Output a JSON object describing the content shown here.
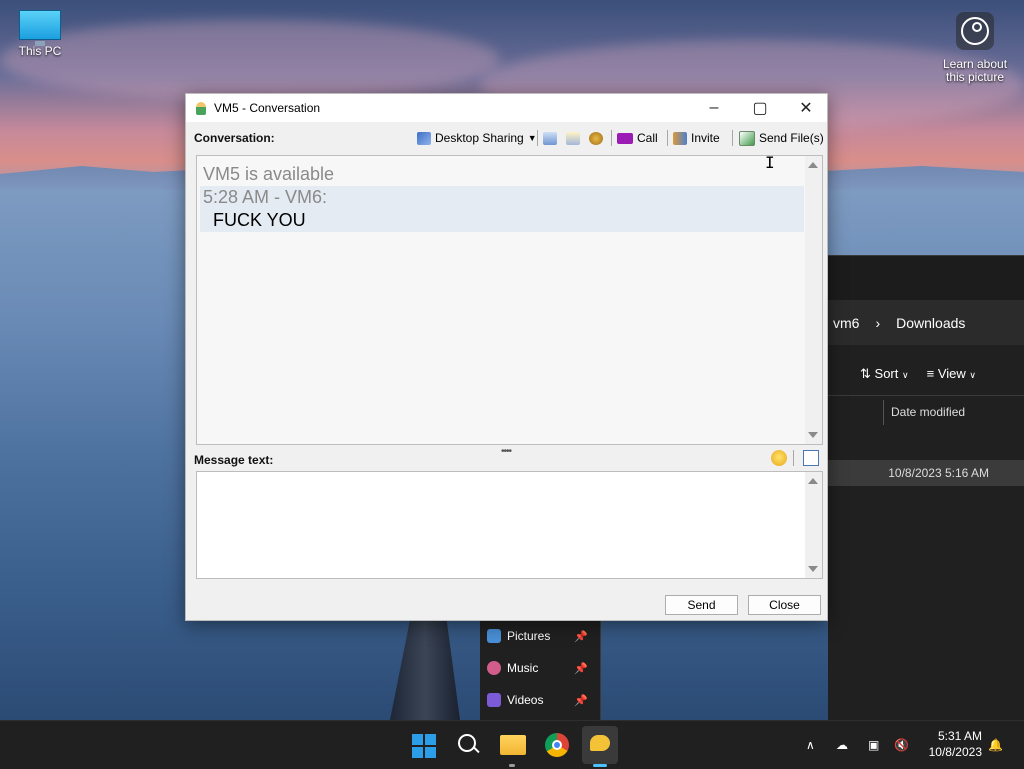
{
  "desktop": {
    "this_pc_label": "This PC",
    "learn_label_1": "Learn about",
    "learn_label_2": "this picture"
  },
  "explorer": {
    "breadcrumb": [
      "vm6",
      "Downloads"
    ],
    "sort_label": "Sort",
    "view_label": "View",
    "column_header": "Date modified",
    "row_date": "10/8/2023 5:16 AM",
    "nav_items": [
      {
        "label": "Pictures",
        "icon": "pictures-icon",
        "color": "#4a90d9"
      },
      {
        "label": "Music",
        "icon": "music-icon",
        "color": "#d35d8a"
      },
      {
        "label": "Videos",
        "icon": "videos-icon",
        "color": "#7b5bd6"
      }
    ]
  },
  "conversation": {
    "title": "VM5 - Conversation",
    "conversation_label": "Conversation:",
    "toolbar": {
      "desktop_sharing": "Desktop Sharing",
      "call": "Call",
      "invite": "Invite",
      "send_files": "Send File(s)"
    },
    "history": {
      "status_line": "VM5 is available",
      "header_line": "5:28 AM - VM6:",
      "message": "FUCK YOU"
    },
    "message_text_label": "Message text:",
    "input_value": "",
    "send_label": "Send",
    "close_label": "Close"
  },
  "taskbar": {
    "time": "5:31 AM",
    "date": "10/8/2023"
  },
  "colors": {
    "accent": "#2b9de9",
    "history_highlight": "#e5ebf3",
    "taskbar": "#202020"
  }
}
